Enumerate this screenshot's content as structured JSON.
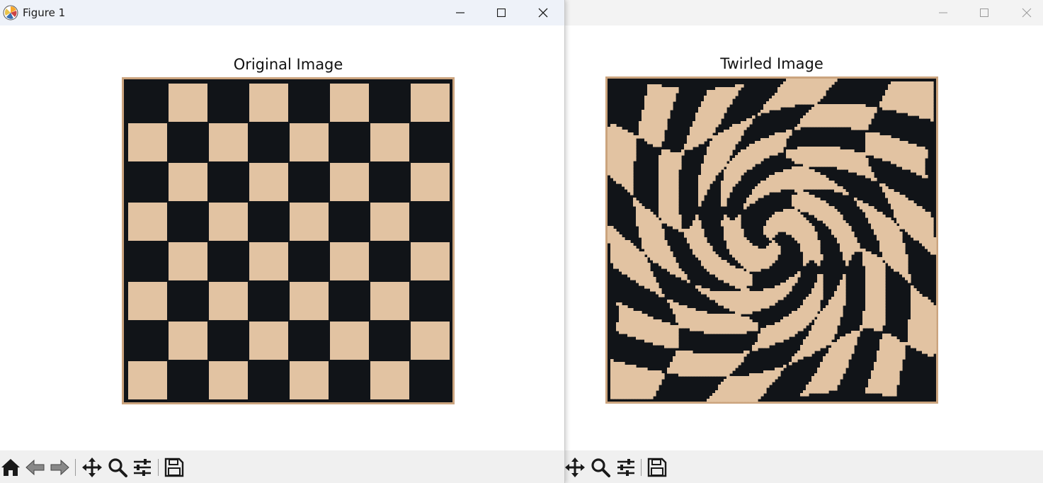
{
  "windows": [
    {
      "title": "Figure 1",
      "axes_title": "Original Image",
      "image": "checkerboard-original"
    },
    {
      "title": "",
      "axes_title": "Twirled Image",
      "image": "checkerboard-twirled"
    }
  ],
  "controls": [
    "minimize-icon",
    "maximize-icon",
    "close-icon"
  ],
  "toolbar": {
    "front_icons": [
      "home-icon",
      "back-arrow-icon",
      "forward-arrow-icon",
      "pan-icon",
      "zoom-icon",
      "configure-subplots-icon",
      "save-icon"
    ],
    "back_icons": [
      "pan-icon",
      "zoom-icon",
      "configure-subplots-icon",
      "save-icon"
    ]
  },
  "colors": {
    "dark_square": "#111418",
    "light_square": "#e2c3a2",
    "board_frame": "#cba47e",
    "title_bar_active": "#eef2f9",
    "title_bar_inactive": "#f3f3f3",
    "toolbar": "#f0f0f0"
  }
}
